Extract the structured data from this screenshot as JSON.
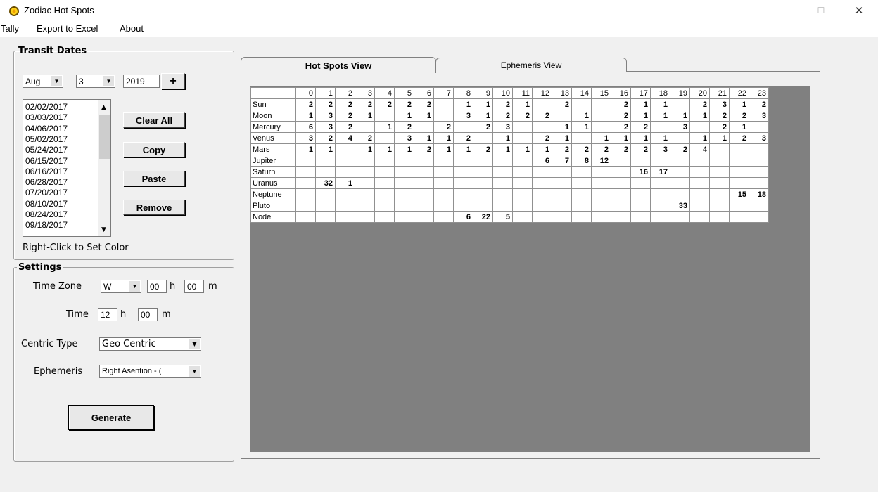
{
  "window": {
    "title": "Zodiac Hot Spots",
    "minimize": "—",
    "maximize": "☐",
    "close": "✕"
  },
  "menu": [
    "Tally",
    "Export to Excel",
    "About"
  ],
  "transit": {
    "legend": "Transit Dates",
    "month": "Aug",
    "day": "3",
    "year": "2019",
    "add_label": "+",
    "dates": [
      "02/02/2017",
      "03/03/2017",
      "04/06/2017",
      "05/02/2017",
      "05/24/2017",
      "06/15/2017",
      "06/16/2017",
      "06/28/2017",
      "07/20/2017",
      "08/10/2017",
      "08/24/2017",
      "09/18/2017"
    ],
    "clear_all": "Clear All",
    "copy": "Copy",
    "paste": "Paste",
    "remove": "Remove",
    "hint": "Right-Click to Set Color"
  },
  "settings": {
    "legend": "Settings",
    "time_zone_label": "Time Zone",
    "tz_dir": "W",
    "tz_hours": "00",
    "tz_minutes": "00",
    "h": "h",
    "m": "m",
    "time_label": "Time",
    "time_hours": "12",
    "time_minutes": "00",
    "centric_label": "Centric Type",
    "centric_value": "Geo Centric",
    "ephemeris_label": "Ephemeris",
    "ephemeris_value": "Right Asention - (",
    "generate": "Generate"
  },
  "tabs": [
    "Hot Spots View",
    "Ephemeris View"
  ],
  "grid": {
    "columns": [
      "0",
      "1",
      "2",
      "3",
      "4",
      "5",
      "6",
      "7",
      "8",
      "9",
      "10",
      "11",
      "12",
      "13",
      "14",
      "15",
      "16",
      "17",
      "18",
      "19",
      "20",
      "21",
      "22",
      "23"
    ],
    "rows": [
      {
        "name": "Sun",
        "cells": [
          "2",
          "2",
          "2",
          "2",
          "2",
          "2",
          "2",
          "",
          "1",
          "1",
          "2",
          "1",
          "",
          "2",
          "",
          "",
          "2",
          "1",
          "1",
          "",
          "2",
          "3",
          "1",
          "2"
        ]
      },
      {
        "name": "Moon",
        "cells": [
          "1",
          "3",
          "2",
          "1",
          "",
          "1",
          "1",
          "",
          "3",
          "1",
          "2",
          "2",
          "2",
          "",
          "1",
          "",
          "2",
          "1",
          "1",
          "1",
          "1",
          "2",
          "2",
          "3"
        ]
      },
      {
        "name": "Mercury",
        "cells": [
          "6",
          "3",
          "2",
          "",
          "1",
          "2",
          "",
          "2",
          "",
          "2",
          "3",
          "",
          "",
          "1",
          "1",
          "",
          "2",
          "2",
          "",
          "3",
          "",
          "2",
          "1",
          ""
        ]
      },
      {
        "name": "Venus",
        "cells": [
          "3",
          "2",
          "4",
          "2",
          "",
          "3",
          "1",
          "1",
          "2",
          "",
          "1",
          "",
          "2",
          "1",
          "",
          "1",
          "1",
          "1",
          "1",
          "",
          "1",
          "1",
          "2",
          "3"
        ]
      },
      {
        "name": "Mars",
        "cells": [
          "1",
          "1",
          "",
          "1",
          "1",
          "1",
          "2",
          "1",
          "1",
          "2",
          "1",
          "1",
          "1",
          "2",
          "2",
          "2",
          "2",
          "2",
          "3",
          "2",
          "4",
          "",
          "",
          ""
        ]
      },
      {
        "name": "Jupiter",
        "cells": [
          "",
          "",
          "",
          "",
          "",
          "",
          "",
          "",
          "",
          "",
          "",
          "",
          "6",
          "7",
          "8",
          "12",
          "",
          "",
          "",
          "",
          "",
          "",
          "",
          ""
        ]
      },
      {
        "name": "Saturn",
        "cells": [
          "",
          "",
          "",
          "",
          "",
          "",
          "",
          "",
          "",
          "",
          "",
          "",
          "",
          "",
          "",
          "",
          "",
          "16",
          "17",
          "",
          "",
          "",
          "",
          ""
        ]
      },
      {
        "name": "Uranus",
        "cells": [
          "",
          "32",
          "1",
          "",
          "",
          "",
          "",
          "",
          "",
          "",
          "",
          "",
          "",
          "",
          "",
          "",
          "",
          "",
          "",
          "",
          "",
          "",
          "",
          ""
        ]
      },
      {
        "name": "Neptune",
        "cells": [
          "",
          "",
          "",
          "",
          "",
          "",
          "",
          "",
          "",
          "",
          "",
          "",
          "",
          "",
          "",
          "",
          "",
          "",
          "",
          "",
          "",
          "",
          "15",
          "18"
        ]
      },
      {
        "name": "Pluto",
        "cells": [
          "",
          "",
          "",
          "",
          "",
          "",
          "",
          "",
          "",
          "",
          "",
          "",
          "",
          "",
          "",
          "",
          "",
          "",
          "",
          "33",
          "",
          "",
          "",
          ""
        ]
      },
      {
        "name": "Node",
        "cells": [
          "",
          "",
          "",
          "",
          "",
          "",
          "",
          "",
          "6",
          "22",
          "5",
          "",
          "",
          "",
          "",
          "",
          "",
          "",
          "",
          "",
          "",
          "",
          "",
          ""
        ]
      }
    ]
  }
}
